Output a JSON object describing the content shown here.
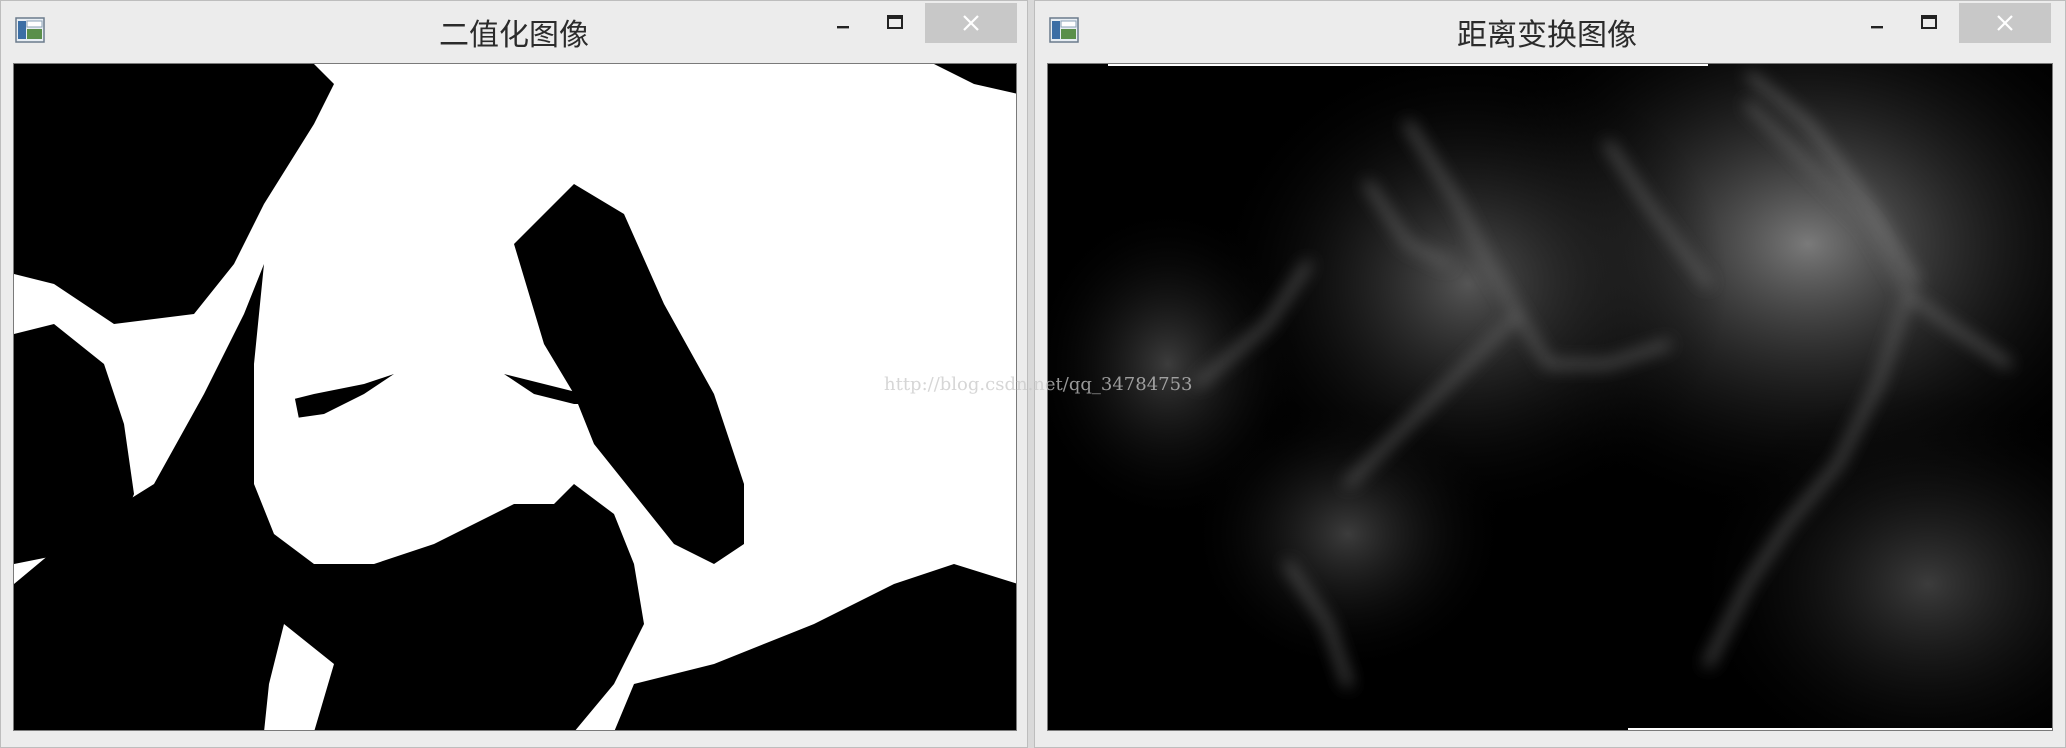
{
  "windows": [
    {
      "title": "二值化图像",
      "controls": [
        "minimize-icon",
        "maximize-icon",
        "close-icon"
      ]
    },
    {
      "title": "距离变换图像",
      "controls": [
        "minimize-icon",
        "maximize-icon",
        "close-icon"
      ]
    }
  ],
  "watermark": "http://blog.csdn.net/qq_34784753"
}
